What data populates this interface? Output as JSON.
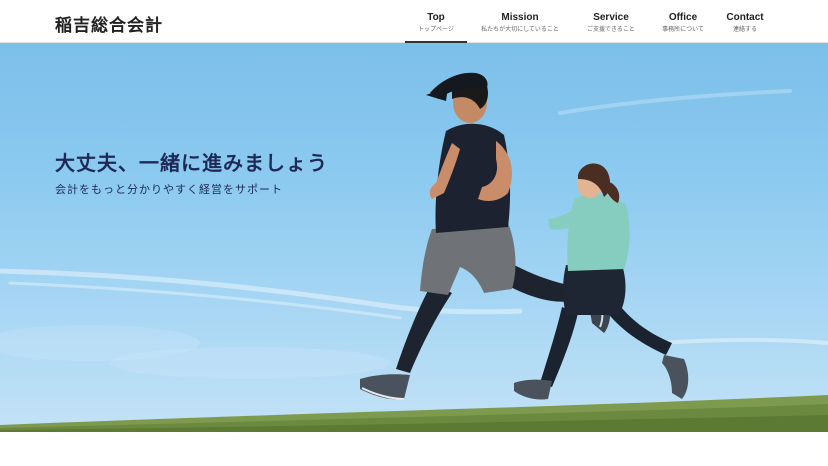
{
  "site": {
    "logo": "稲吉総合会計"
  },
  "nav": {
    "items": [
      {
        "en": "Top",
        "jp": "トップページ",
        "active": true
      },
      {
        "en": "Mission",
        "jp": "私たちが大切にしていること"
      },
      {
        "en": "Service",
        "jp": "ご支援できること"
      },
      {
        "en": "Office",
        "jp": "事務所について"
      },
      {
        "en": "Contact",
        "jp": "連絡する"
      }
    ]
  },
  "hero": {
    "headline": "大丈夫、一緒に進みましょう",
    "subline": "会計をもっと分かりやすく経営をサポート",
    "image": "runners-on-grass-photo"
  },
  "colors": {
    "sky": "#8ccaf0",
    "headline": "#1e2a55",
    "grass": "#7e9a4e"
  }
}
